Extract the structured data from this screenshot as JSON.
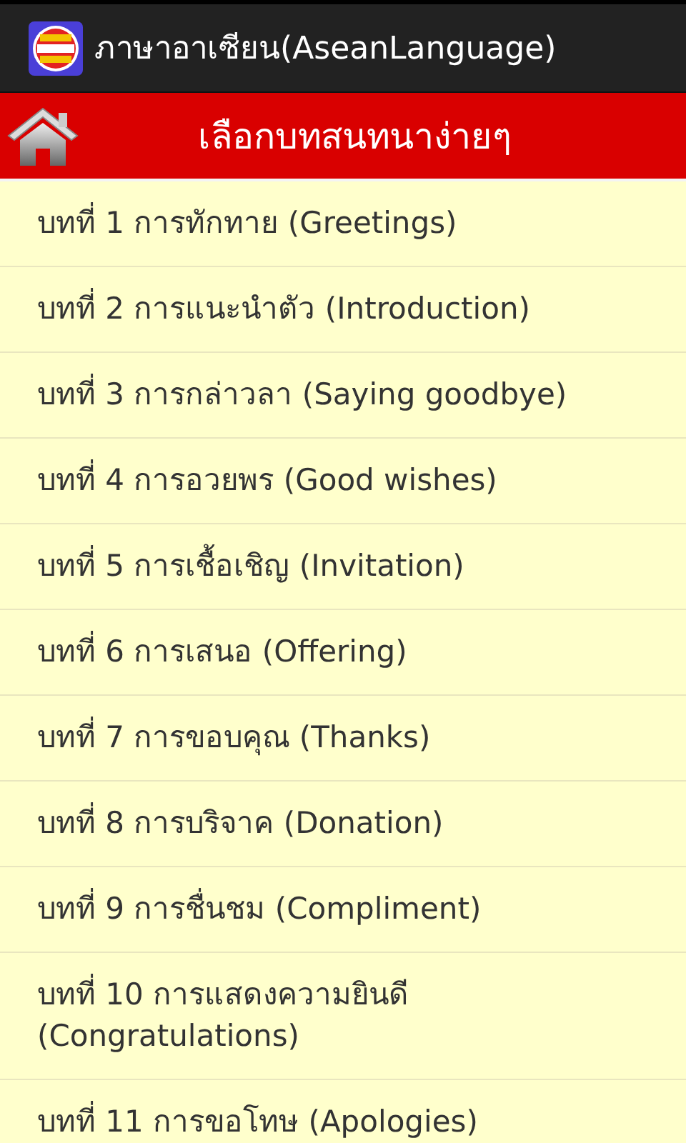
{
  "app_bar": {
    "title": "ภาษาอาเซียน(AseanLanguage)"
  },
  "header": {
    "title": "เลือกบทสนทนาง่ายๆ"
  },
  "lessons": [
    {
      "label": "บทที่ 1 การทักทาย (Greetings)"
    },
    {
      "label": "บทที่ 2 การแนะนำตัว (Introduction)"
    },
    {
      "label": "บทที่ 3 การกล่าวลา (Saying goodbye)"
    },
    {
      "label": "บทที่ 4 การอวยพร (Good wishes)"
    },
    {
      "label": "บทที่ 5 การเชื้อเชิญ (Invitation)"
    },
    {
      "label": "บทที่ 6 การเสนอ (Offering)"
    },
    {
      "label": "บทที่ 7 การขอบคุณ (Thanks)"
    },
    {
      "label": "บทที่ 8 การบริจาค (Donation)"
    },
    {
      "label": "บทที่ 9 การชื่นชม (Compliment)"
    },
    {
      "label": "บทที่ 10 การแสดงความยินดี (Congratulations)"
    },
    {
      "label": "บทที่ 11 การขอโทษ (Apologies)"
    }
  ]
}
